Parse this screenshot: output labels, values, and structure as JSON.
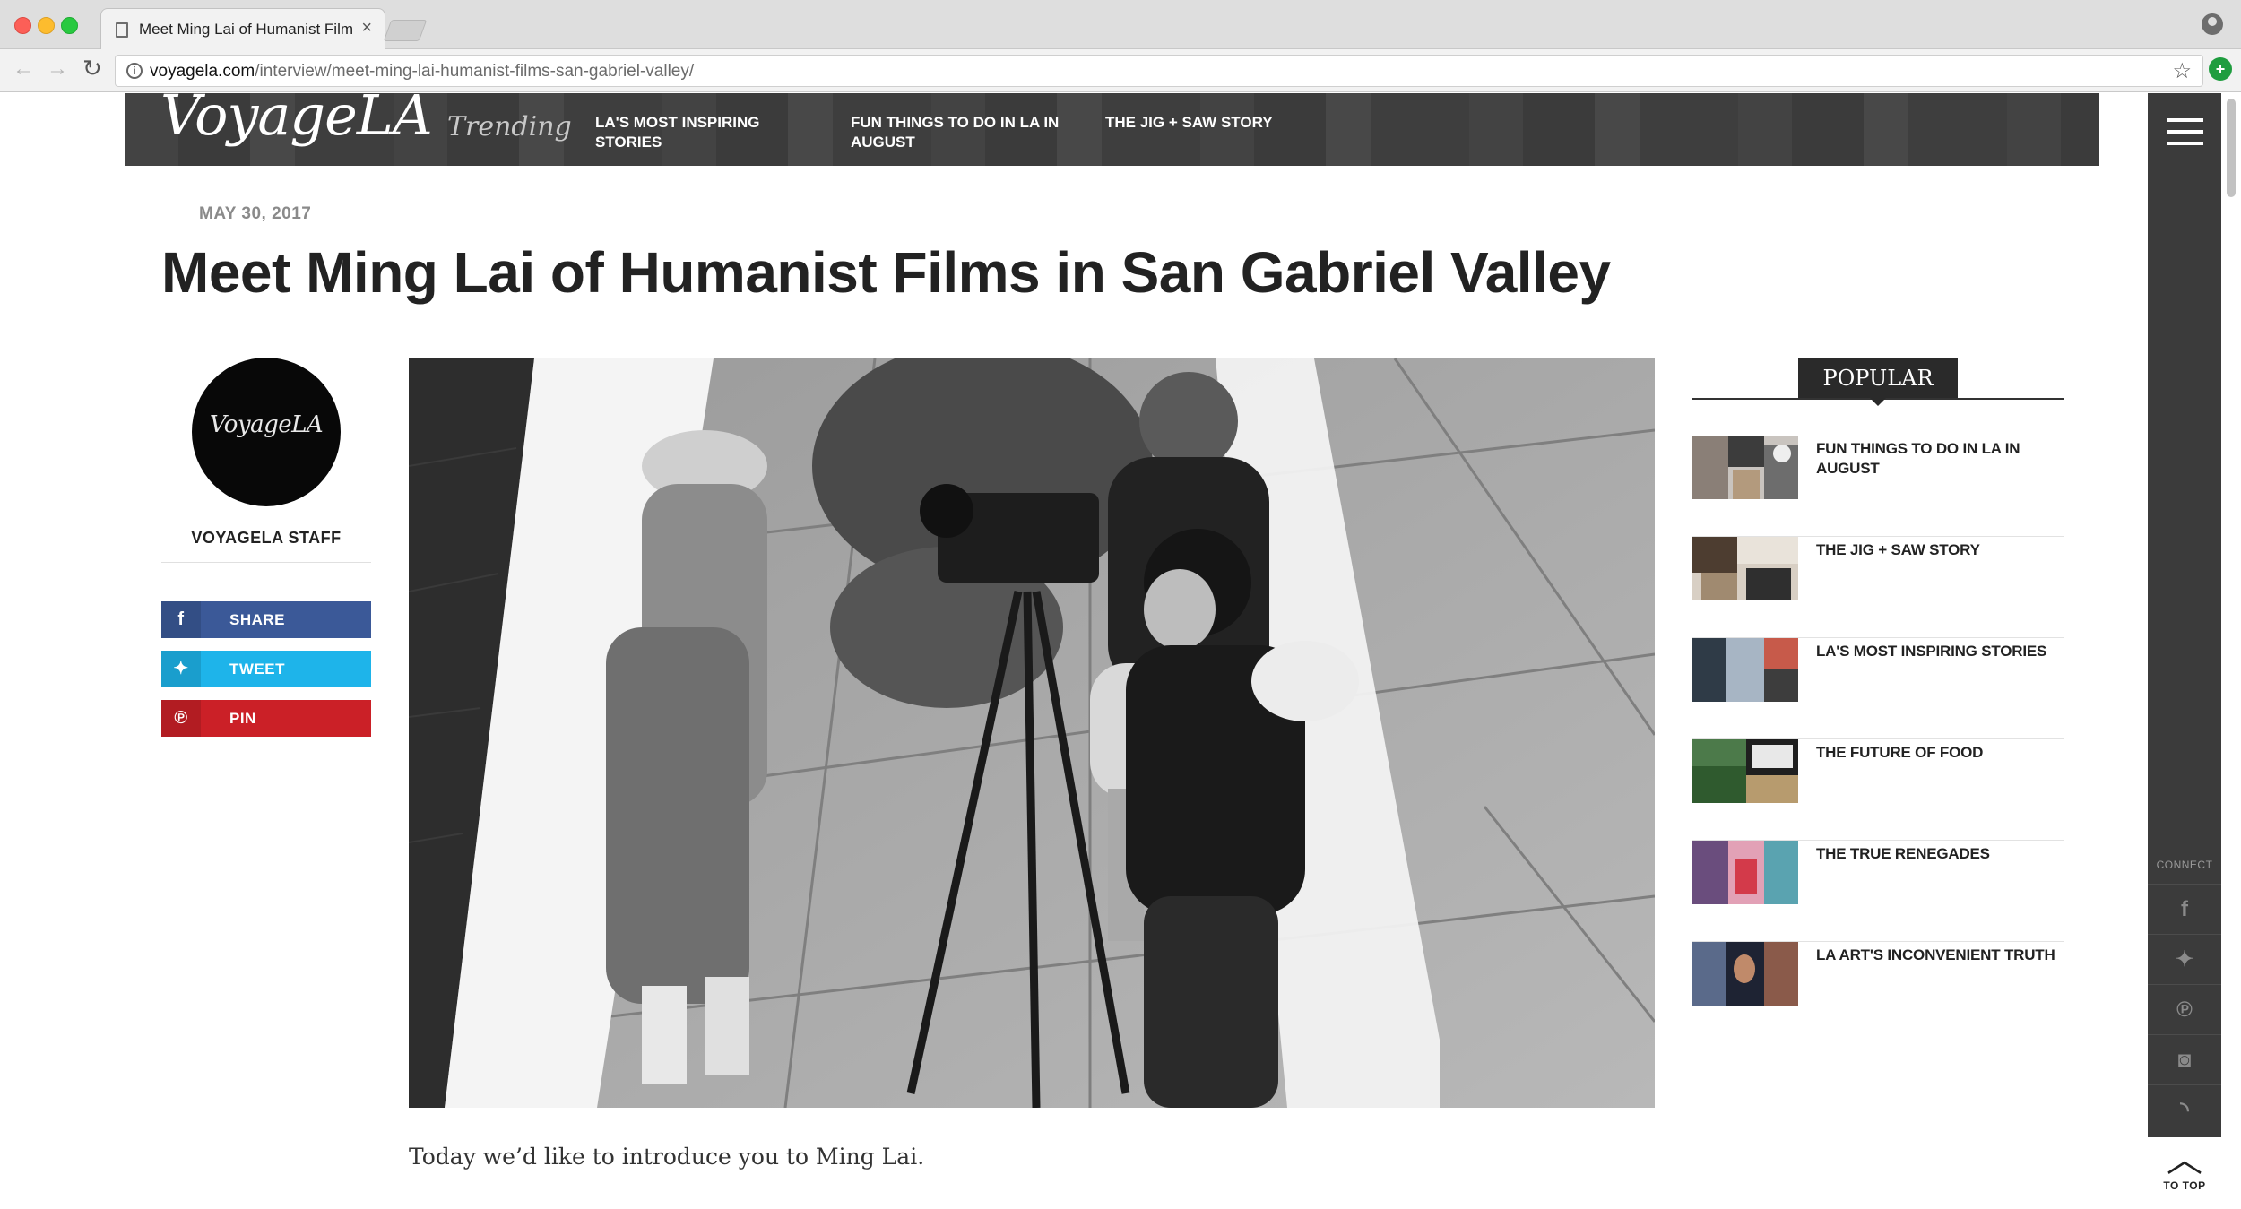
{
  "browser": {
    "tab_title": "Meet Ming Lai of Humanist Film",
    "tab_close": "×",
    "url_host": "voyagela.com",
    "url_path": "/interview/meet-ming-lai-humanist-films-san-gabriel-valley/",
    "back_glyph": "←",
    "forward_glyph": "→",
    "reload_glyph": "↻",
    "info_glyph": "i",
    "star_glyph": "☆",
    "ext_glyph": "+"
  },
  "header": {
    "logo": "VoyageLA",
    "trending_label": "Trending",
    "trending_links": [
      {
        "label": "LA'S MOST INSPIRING STORIES"
      },
      {
        "label": "FUN THINGS TO DO IN LA IN AUGUST"
      },
      {
        "label": "THE JIG + SAW STORY"
      }
    ]
  },
  "article": {
    "date": "MAY 30, 2017",
    "title": "Meet Ming Lai of Humanist Films in San Gabriel Valley",
    "intro": "Today we’d like to introduce you to Ming Lai."
  },
  "author": {
    "avatar_text": "VoyageLA",
    "name": "VOYAGELA STAFF"
  },
  "share": {
    "share_label": "SHARE",
    "tweet_label": "TWEET",
    "pin_label": "PIN",
    "facebook_glyph": "f",
    "twitter_glyph": "✦",
    "pinterest_glyph": "℗",
    "colors": {
      "facebook": "#3b5998",
      "twitter": "#1eb4ea",
      "pinterest": "#cb2027"
    }
  },
  "popular": {
    "heading": "POPULAR",
    "items": [
      {
        "title": "FUN THINGS TO DO IN LA IN AUGUST"
      },
      {
        "title": "THE JIG + SAW STORY"
      },
      {
        "title": "LA'S MOST INSPIRING STORIES"
      },
      {
        "title": "THE FUTURE OF FOOD"
      },
      {
        "title": "THE TRUE RENEGADES"
      },
      {
        "title": "LA ART'S INCONVENIENT TRUTH"
      }
    ]
  },
  "sidebar": {
    "connect_label": "CONNECT",
    "icons": [
      {
        "name": "facebook-icon",
        "glyph": "f"
      },
      {
        "name": "twitter-icon",
        "glyph": "✦"
      },
      {
        "name": "pinterest-icon",
        "glyph": "℗"
      },
      {
        "name": "instagram-icon",
        "glyph": "◙"
      },
      {
        "name": "rss-icon",
        "glyph": "◝"
      }
    ],
    "to_top_label": "TO TOP",
    "to_top_glyph": "︿"
  }
}
